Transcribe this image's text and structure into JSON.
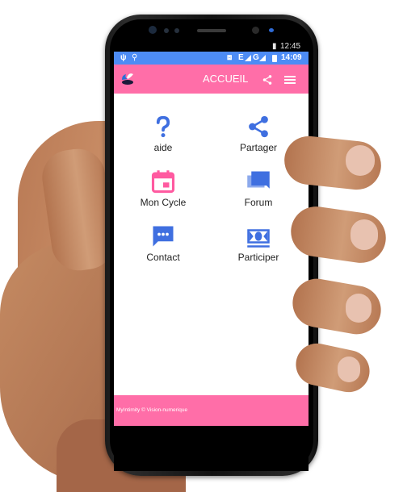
{
  "status_top": {
    "time": "12:45"
  },
  "status_bar": {
    "signal": "E",
    "network": "G",
    "time": "14:09"
  },
  "app_bar": {
    "title": "ACCUEIL"
  },
  "menu": [
    {
      "label": "aide",
      "icon": "help-icon"
    },
    {
      "label": "Partager",
      "icon": "share-icon"
    },
    {
      "label": "Mon Cycle",
      "icon": "calendar-icon"
    },
    {
      "label": "Forum",
      "icon": "forum-icon"
    },
    {
      "label": "Contact",
      "icon": "chat-icon"
    },
    {
      "label": "Participer",
      "icon": "money-icon"
    }
  ],
  "footer": {
    "text": "MyIntimity © Vision-numerique"
  },
  "colors": {
    "primary": "#ff6ea8",
    "status": "#4d8cf5",
    "icon_blue": "#3f6fe0",
    "icon_pink": "#ff5aa0"
  }
}
